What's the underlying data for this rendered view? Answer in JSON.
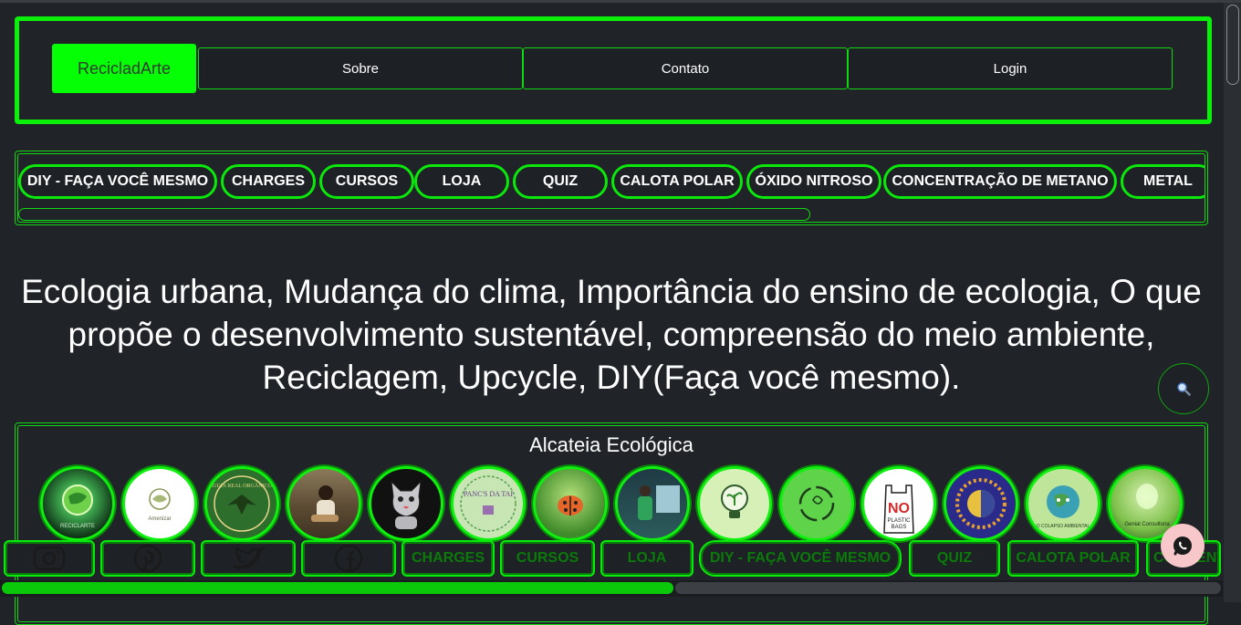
{
  "brand": "RecicladArte",
  "nav": [
    "Sobre",
    "Contato",
    "Login"
  ],
  "categories": [
    "DIY - FAÇA VOCÊ MESMO",
    "CHARGES",
    "CURSOS",
    "LOJA",
    "QUIZ",
    "CALOTA POLAR",
    "ÓXIDO NITROSO",
    "CONCENTRAÇÃO DE METANO",
    "METAL"
  ],
  "headline": "Ecologia urbana, Mudança do clima, Importância do ensino de ecologia, O que propõe o desenvolvimento sustentável, compreensão do meio ambiente, Reciclagem, Upcycle, DIY(Faça você mesmo).",
  "alcateia": {
    "title": "Alcateia Ecológica",
    "items": [
      {
        "icon": "globe-logo",
        "caption": "RECICLARTE"
      },
      {
        "icon": "leaf-logo",
        "caption": "Amenizar"
      },
      {
        "icon": "eagle-logo",
        "caption": "ÁGUIA REAL ORGÂNICOS"
      },
      {
        "icon": "person-photo",
        "caption": ""
      },
      {
        "icon": "cat-logo",
        "caption": ""
      },
      {
        "icon": "pancs-logo",
        "caption": "PANC'S DA TAI"
      },
      {
        "icon": "ladybug-photo",
        "caption": ""
      },
      {
        "icon": "person-photo",
        "caption": ""
      },
      {
        "icon": "bulb-logo",
        "caption": ""
      },
      {
        "icon": "recycle-logo",
        "caption": ""
      },
      {
        "icon": "no-plastic-bags-logo",
        "caption": "NO PLASTIC BAGS"
      },
      {
        "icon": "sun-moon-logo",
        "caption": ""
      },
      {
        "icon": "earth-logo",
        "caption": "O COLAPSO AMBIENTAL"
      },
      {
        "icon": "bulb-photo",
        "caption": "Genial Consultoria"
      }
    ]
  },
  "bottom": {
    "social": [
      "instagram-icon",
      "pinterest-icon",
      "twitter-icon",
      "facebook-icon"
    ],
    "links": [
      "CHARGES",
      "CURSOS",
      "LOJA",
      "DIY - FAÇA VOCÊ MESMO",
      "QUIZ",
      "CALOTA POLAR",
      "CONCENTRAÇÃO DE METANO"
    ]
  },
  "colors": {
    "accent": "#0bf00b",
    "background": "#202327"
  }
}
